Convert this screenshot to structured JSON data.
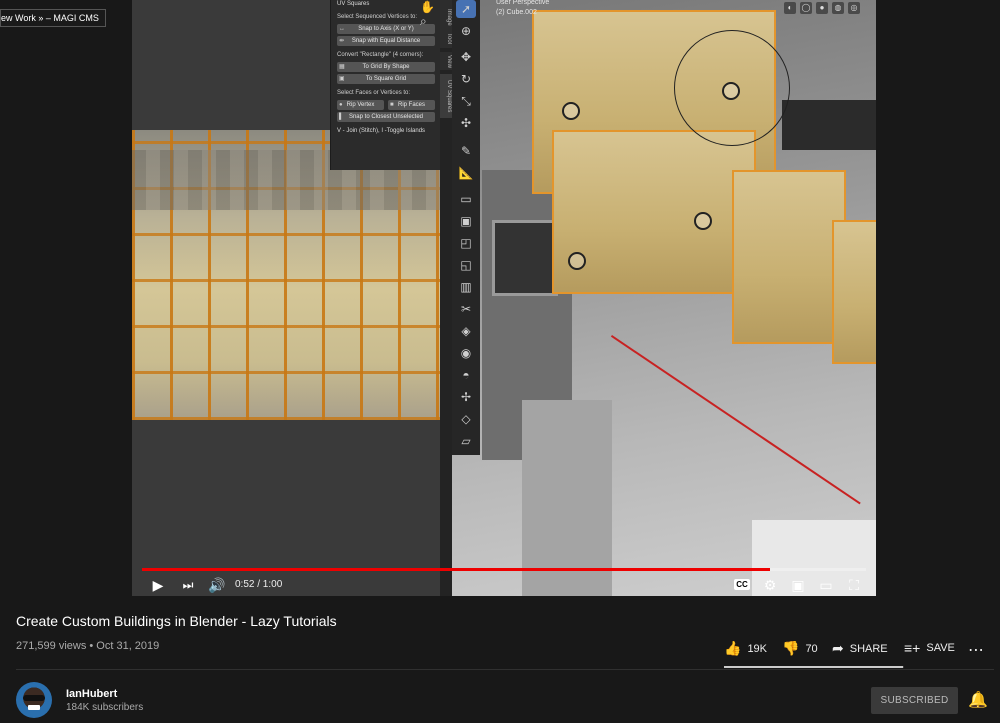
{
  "tooltip": "ew Work » – MAGI CMS",
  "player": {
    "uv_panel": {
      "header": "UV Squares",
      "sec1": "Select Sequenced Vertices to:",
      "btn_snap_axis": "Snap to Axis (X or Y)",
      "btn_snap_equal": "Snap with Equal Distance",
      "sec2": "Convert \"Rectangle\" (4 corners):",
      "btn_grid_shape": "To Grid By Shape",
      "btn_square_grid": "To Square Grid",
      "sec3": "Select Faces or Vertices to:",
      "btn_rip_vertex": "Rip Vertex",
      "btn_rip_faces": "Rip Faces",
      "btn_snap_closest": "Snap to Closest Unselected",
      "note": "V - Join (Stitch), I -Toggle Islands"
    },
    "side_tabs": [
      "Image",
      "Tool",
      "View",
      "UV Squares"
    ],
    "viewport": {
      "line1": "User Perspective",
      "line2": "(2) Cube.002"
    },
    "controls": {
      "time": "0:52 / 1:00",
      "progress_fraction": 0.867,
      "cc_label": "CC"
    }
  },
  "video": {
    "title": "Create Custom Buildings in Blender - Lazy Tutorials",
    "meta": "271,599 views • Oct 31, 2019",
    "likes": "19K",
    "dislikes": "70",
    "share": "SHARE",
    "save": "SAVE",
    "like_fraction": 0.996
  },
  "channel": {
    "name": "IanHubert",
    "subscribers": "184K subscribers",
    "subscribe_label": "SUBSCRIBED"
  },
  "colors": {
    "progress": "#ee0000",
    "background": "#181818",
    "selection_orange": "#e3952c"
  }
}
